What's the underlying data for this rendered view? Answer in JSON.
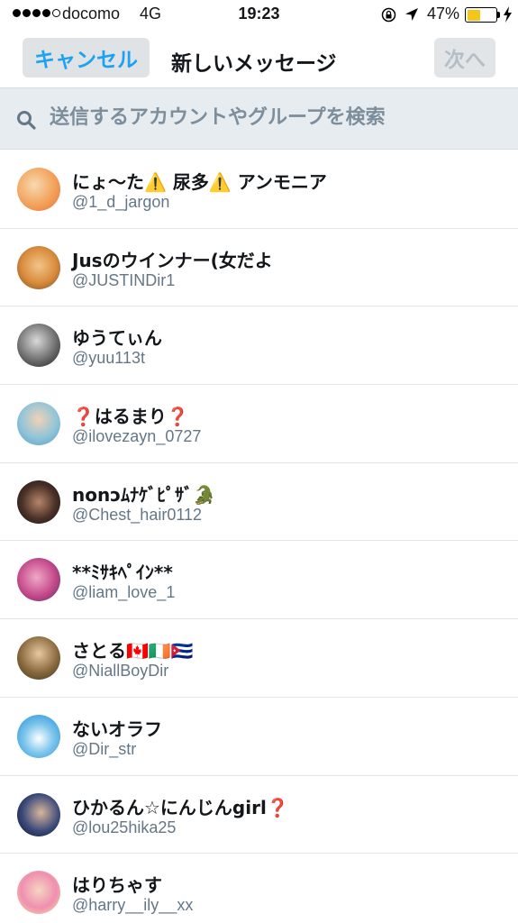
{
  "status_bar": {
    "carrier": "docomo",
    "network": "4G",
    "time": "19:23",
    "battery_percent": "47%",
    "battery_level": 0.47,
    "battery_color": "#f5c518"
  },
  "nav": {
    "cancel_label": "キャンセル",
    "title": "新しいメッセージ",
    "next_label": "次へ",
    "accent_color": "#1da1f2"
  },
  "search": {
    "placeholder": "送信するアカウントやグループを検索",
    "value": ""
  },
  "users": [
    {
      "name": "にょ〜た⚠️ 尿多⚠️ アンモニア",
      "handle": "@1_d_jargon"
    },
    {
      "name": "Jusのウインナー(女だよ",
      "handle": "@JUSTINDir1"
    },
    {
      "name": "ゆうてぃん",
      "handle": "@yuu113t"
    },
    {
      "name": "❓はるまり❓",
      "handle": "@ilovezayn_0727"
    },
    {
      "name": "nonↄﾑﾅｹﾞﾋﾟｻﾞ🐊",
      "handle": "@Chest_hair0112"
    },
    {
      "name": "**ﾐｻｷﾍﾟｲﾝ**",
      "handle": "@liam_love_1"
    },
    {
      "name": "さとる🇨🇦🇮🇪🇨🇺",
      "handle": "@NiallBoyDir"
    },
    {
      "name": "ないオラフ",
      "handle": "@Dir_str"
    },
    {
      "name": "ひかるん☆にんじんgirl❓",
      "handle": "@lou25hika25"
    },
    {
      "name": "はりちゃす",
      "handle": "@harry__ily__xx"
    }
  ]
}
